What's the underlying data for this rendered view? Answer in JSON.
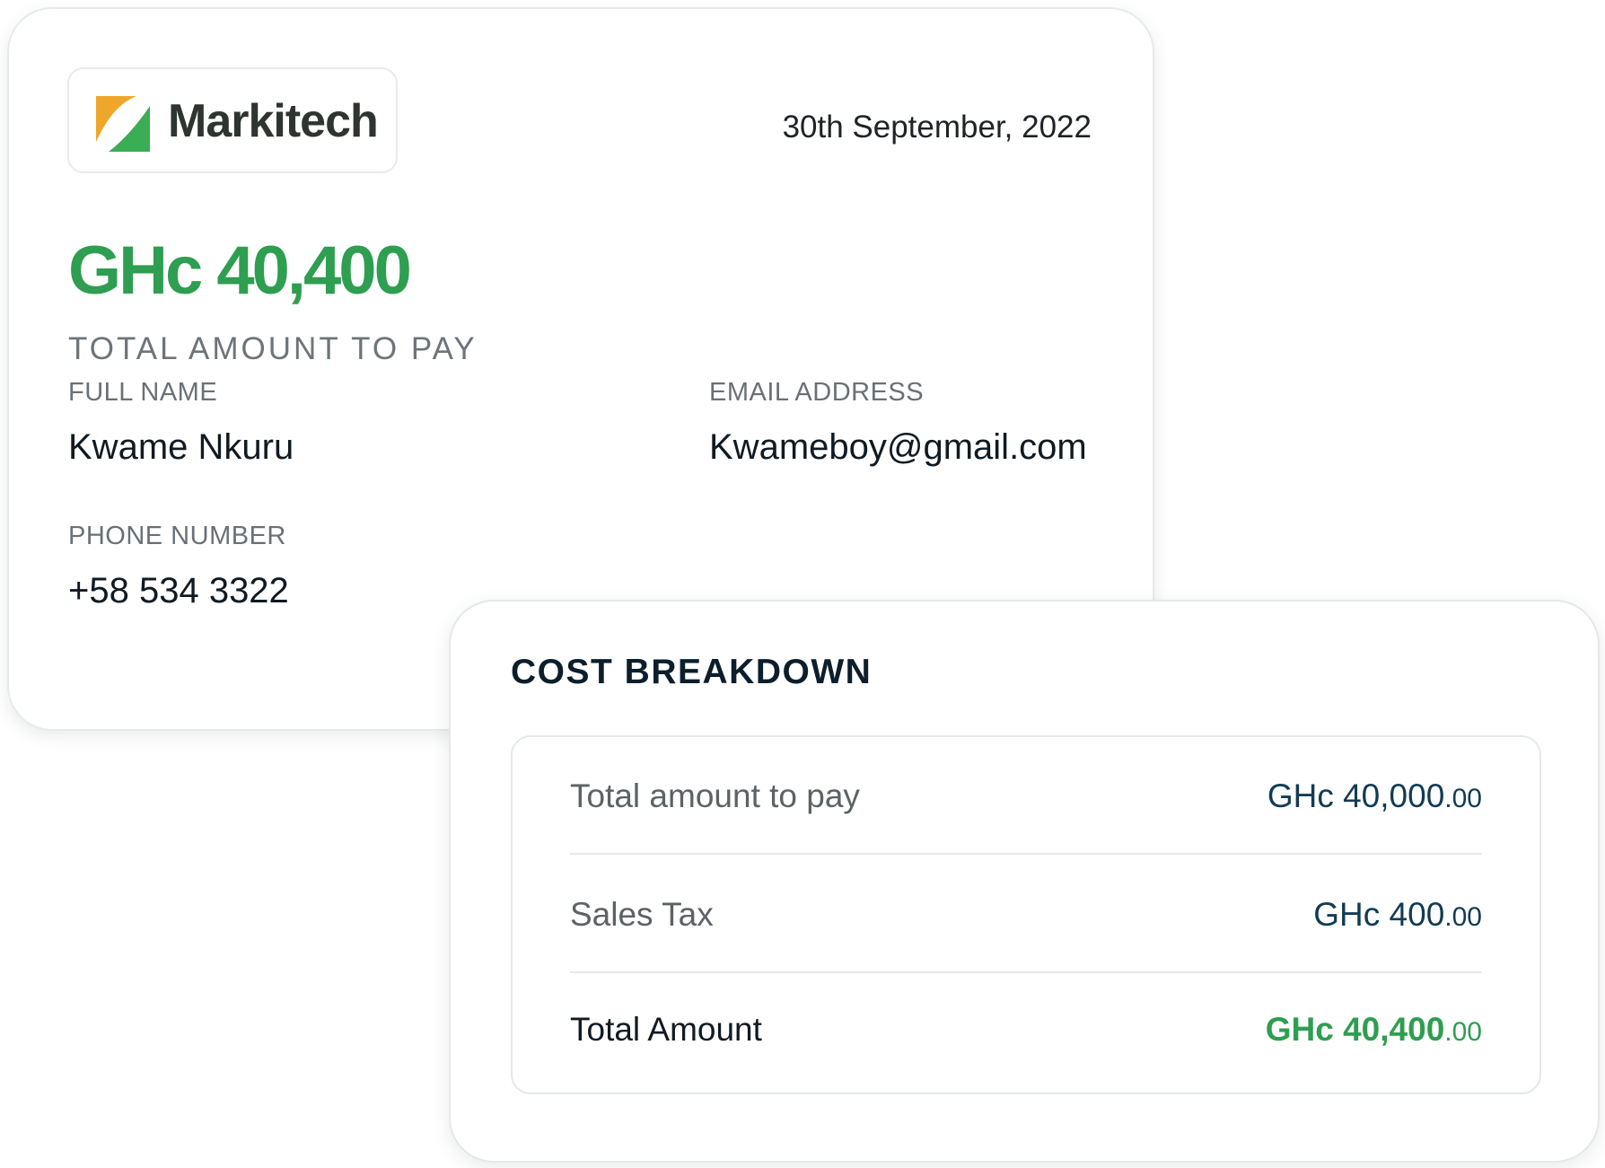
{
  "invoice": {
    "brand_name": "Markitech",
    "date": "30th September, 2022",
    "total_amount": "GHc 40,400",
    "total_amount_label": "TOTAL AMOUNT TO PAY",
    "fields": {
      "full_name": {
        "label": "FULL NAME",
        "value": "Kwame Nkuru"
      },
      "email": {
        "label": "EMAIL ADDRESS",
        "value": "Kwameboy@gmail.com"
      },
      "phone": {
        "label": "PHONE NUMBER",
        "value": "+58 534 3322"
      }
    }
  },
  "cost_breakdown": {
    "title": "COST BREAKDOWN",
    "rows": [
      {
        "label": "Total amount to pay",
        "value": "GHc 40,000",
        "cents": ".00"
      },
      {
        "label": "Sales Tax",
        "value": "GHc 400",
        "cents": ".00"
      },
      {
        "label": "Total Amount",
        "value": "GHc 40,400",
        "cents": ".00"
      }
    ]
  },
  "colors": {
    "accent_green": "#2e9e50",
    "logo_orange": "#eea72a",
    "logo_green": "#3aad55",
    "value_navy": "#123b54"
  },
  "icons": {
    "brand_logo": "markitech-logo-icon"
  }
}
